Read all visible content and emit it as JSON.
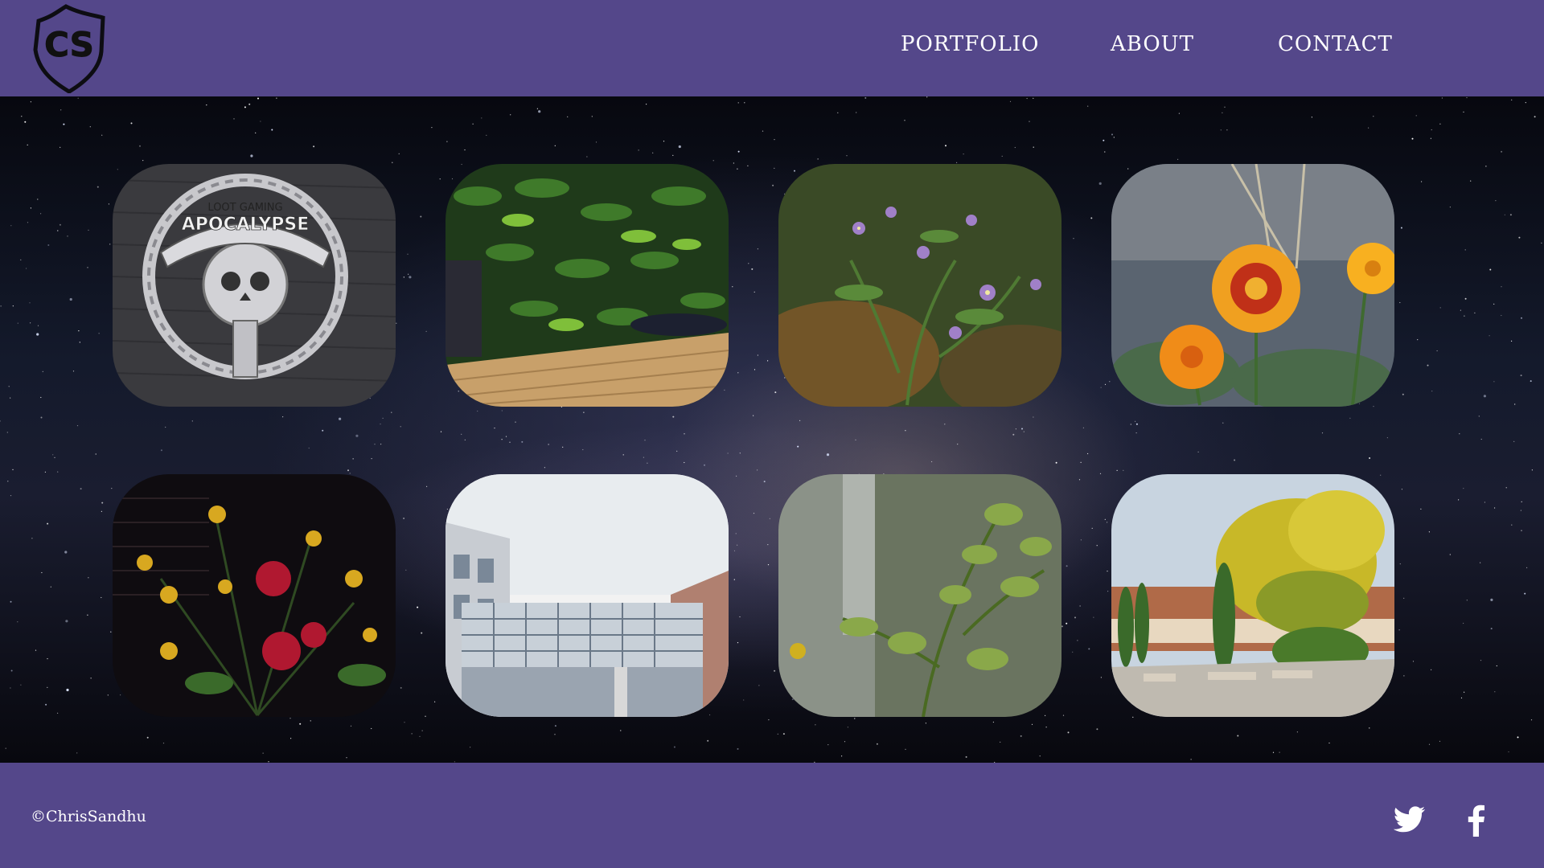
{
  "header": {
    "logo_letters": "CS",
    "nav": {
      "portfolio": "PORTFOLIO",
      "about": "ABOUT",
      "contact": "CONTACT"
    }
  },
  "gallery": {
    "tiles": [
      {
        "subject": "Loot Gaming Apocalypse skull pin",
        "pin_text_top": "LOOT GAMING",
        "pin_text_main": "APOCALYPSE"
      },
      {
        "subject": "living green wall with photographers"
      },
      {
        "subject": "purple aster flowers"
      },
      {
        "subject": "orange marigold flowers"
      },
      {
        "subject": "yellow and red flowers at night"
      },
      {
        "subject": "glass skywalk between buildings"
      },
      {
        "subject": "green leafy plant close-up"
      },
      {
        "subject": "yellow autumn tree and cypresses"
      }
    ]
  },
  "footer": {
    "copyright": "©ChrisSandhu",
    "social": [
      "twitter-icon",
      "facebook-icon"
    ]
  },
  "colors": {
    "brand_purple": "#54478a",
    "text": "#ffffff"
  }
}
